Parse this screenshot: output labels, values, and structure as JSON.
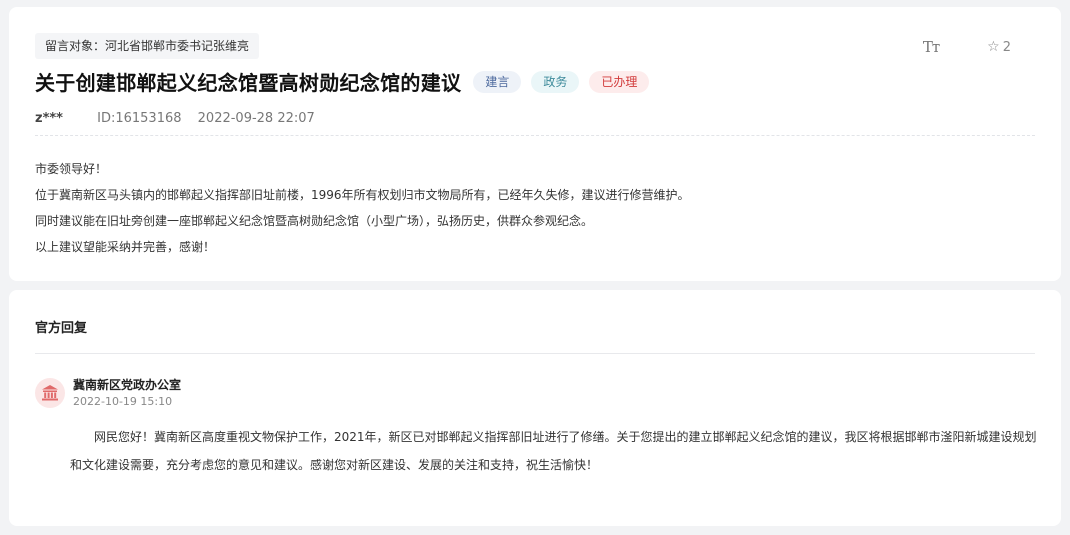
{
  "message": {
    "target_label": "留言对象：河北省邯郸市委书记张维亮",
    "title": "关于创建邯郸起义纪念馆暨高树勋纪念馆的建议",
    "tags": [
      "建言",
      "政务",
      "已办理"
    ],
    "user": "z***",
    "id_text": "ID:16153168",
    "datetime": "2022-09-28 22:07",
    "body_lines": [
      "市委领导好！",
      "位于冀南新区马头镇内的邯郸起义指挥部旧址前楼，1996年所有权划归市文物局所有，已经年久失修，建议进行修营维护。",
      "同时建议能在旧址旁创建一座邯郸起义纪念馆暨高树勋纪念馆（小型广场），弘扬历史，供群众参观纪念。",
      "以上建议望能采纳并完善，感谢！"
    ]
  },
  "toolbar": {
    "font_size_label": "Tт",
    "font_size_icon": "font-size-icon",
    "star_icon": "star-icon",
    "star_count": "2"
  },
  "reply": {
    "header": "官方回复",
    "department": "冀南新区党政办公室",
    "datetime": "2022-10-19 15:10",
    "avatar_icon": "government-building-icon",
    "body": "网民您好！冀南新区高度重视文物保护工作，2021年，新区已对邯郸起义指挥部旧址进行了修缮。关于您提出的建立邯郸起义纪念馆的建议，我区将根据邯郸市滏阳新城建设规划和文化建设需要，充分考虑您的意见和建议。感谢您对新区建设、发展的关注和支持，祝生活愉快！"
  },
  "colors": {
    "background": "#f2f3f5",
    "tag_blue": "#4d6a9e",
    "tag_teal": "#3e8b9b",
    "tag_red": "#d23c3c",
    "avatar_red": "#e06a6a"
  }
}
